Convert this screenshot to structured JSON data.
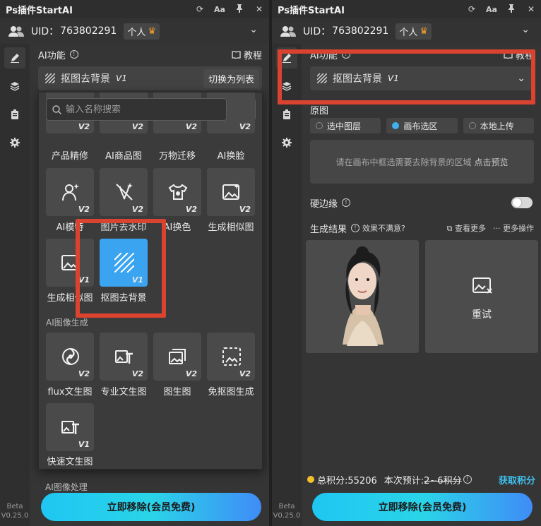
{
  "app": {
    "title": "Ps插件StartAI",
    "uid_label": "UID：",
    "uid_value": "763802291",
    "account_type": "个人",
    "version_tag": "Beta",
    "version": "V0.25.0"
  },
  "left_panel": {
    "ai_function_label": "AI功能",
    "tutorial_label": "教程",
    "current_feature": "抠图去背景",
    "current_feature_version": "V1",
    "switch_to_list": "切换为列表",
    "search_placeholder": "输入名称搜索",
    "row1": [
      {
        "label": "产品精修",
        "ver": "V2"
      },
      {
        "label": "AI商品图",
        "ver": "V2"
      },
      {
        "label": "万物迁移",
        "ver": "V2"
      },
      {
        "label": "AI换脸",
        "ver": "V2"
      }
    ],
    "row2": [
      {
        "label": "AI模特",
        "ver": "V2"
      },
      {
        "label": "图片去水印",
        "ver": "V2"
      },
      {
        "label": "AI换色",
        "ver": "V2"
      },
      {
        "label": "生成相似图",
        "ver": "V2"
      }
    ],
    "row3": [
      {
        "label": "生成相似图",
        "ver": "V1"
      },
      {
        "label": "抠图去背景",
        "ver": "V1"
      }
    ],
    "group_generate": "AI图像生成",
    "row4": [
      {
        "label": "flux文生图",
        "ver": "V2"
      },
      {
        "label": "专业文生图",
        "ver": "V2"
      },
      {
        "label": "图生图",
        "ver": "V2"
      },
      {
        "label": "免抠图生成",
        "ver": "V2"
      }
    ],
    "row5": [
      {
        "label": "快速文生图",
        "ver": "V1"
      }
    ],
    "group_process": "AI图像处理",
    "remove_button": "立即移除(会员免费)"
  },
  "right_panel": {
    "ai_function_label": "AI功能",
    "tutorial_label": "教程",
    "current_feature": "抠图去背景",
    "current_feature_version": "V1",
    "source_label": "原图",
    "source_options": [
      "选中图层",
      "画布选区",
      "本地上传"
    ],
    "selected_source": "画布选区",
    "hint_text": "请在画布中框选需要去除背景的区域",
    "hint_link": "点击预览",
    "hard_edge_label": "硬边缘",
    "hard_edge_on": false,
    "results_label": "生成结果",
    "not_satisfied": "效果不满意?",
    "view_more": "查看更多",
    "more_actions": "更多操作",
    "retry_label": "重试",
    "points_label": "总积分:55206",
    "estimate_label": "本次预计:",
    "estimate_value": "2~6积分",
    "earn_points": "获取积分",
    "remove_button": "立即移除(会员免费)"
  },
  "colors": {
    "accent_blue": "#3aa4f0",
    "highlight_red": "#d9432f",
    "crown_orange": "#f2a12a",
    "earn_points_cyan": "#40c0f0"
  }
}
